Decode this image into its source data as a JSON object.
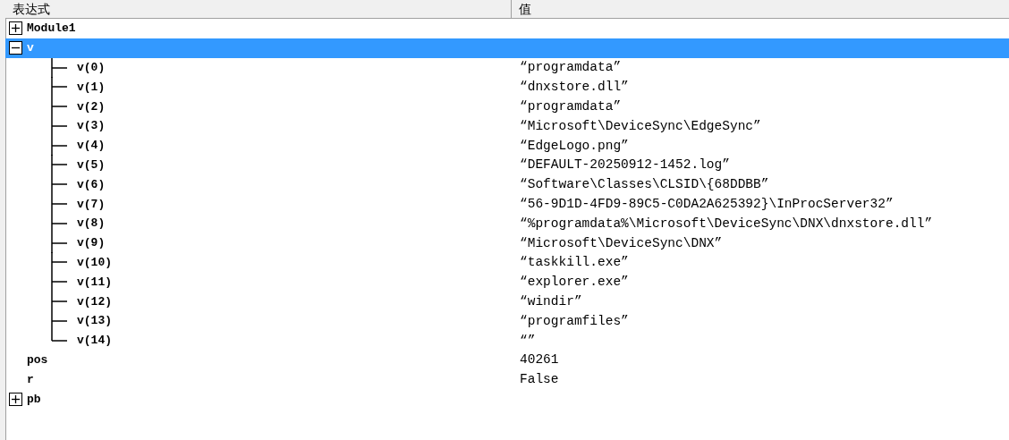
{
  "columns": [
    "表达式",
    "值"
  ],
  "rows": [
    {
      "name": "Module1",
      "expandable": true,
      "expanded": false,
      "selected": false
    },
    {
      "name": "v",
      "expandable": true,
      "expanded": true,
      "selected": true,
      "children": [
        {
          "name": "v(0)",
          "value": "“programdata”",
          "selected": false
        },
        {
          "name": "v(1)",
          "value": "“dnxstore.dll”",
          "selected": false
        },
        {
          "name": "v(2)",
          "value": "“programdata”",
          "selected": false
        },
        {
          "name": "v(3)",
          "value": "“Microsoft\\DeviceSync\\EdgeSync”",
          "selected": false
        },
        {
          "name": "v(4)",
          "value": "“EdgeLogo.png”",
          "selected": false
        },
        {
          "name": "v(5)",
          "value": "“DEFAULT-20250912-1452.log”",
          "selected": false
        },
        {
          "name": "v(6)",
          "value": "“Software\\Classes\\CLSID\\{68DDBB”",
          "selected": false
        },
        {
          "name": "v(7)",
          "value": "“56-9D1D-4FD9-89C5-C0DA2A625392}\\InProcServer32”",
          "selected": false
        },
        {
          "name": "v(8)",
          "value": "“%programdata%\\Microsoft\\DeviceSync\\DNX\\dnxstore.dll”",
          "selected": false
        },
        {
          "name": "v(9)",
          "value": "“Microsoft\\DeviceSync\\DNX”",
          "selected": false
        },
        {
          "name": "v(10)",
          "value": "“taskkill.exe”",
          "selected": false
        },
        {
          "name": "v(11)",
          "value": "“explorer.exe”",
          "selected": false
        },
        {
          "name": "v(12)",
          "value": "“windir”",
          "selected": false
        },
        {
          "name": "v(13)",
          "value": "“programfiles”",
          "selected": false
        },
        {
          "name": "v(14)",
          "value": "“”",
          "selected": false
        }
      ]
    },
    {
      "name": "pos",
      "value": "40261",
      "expandable": false,
      "selected": false
    },
    {
      "name": "r",
      "value": "False",
      "expandable": false,
      "selected": false
    },
    {
      "name": "pb",
      "expandable": true,
      "expanded": false,
      "selected": false
    }
  ]
}
